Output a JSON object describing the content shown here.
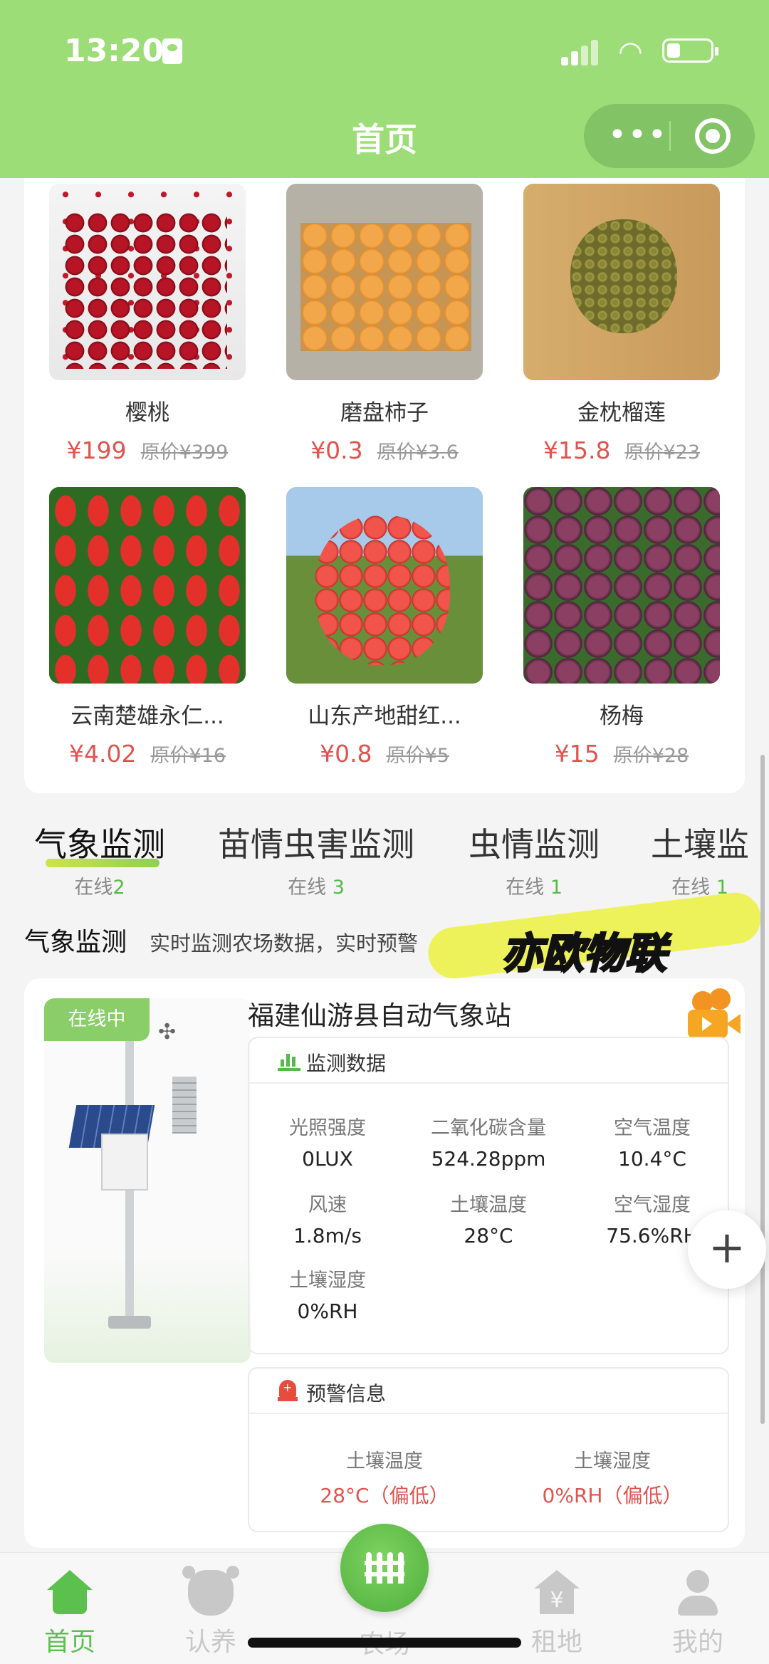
{
  "status_bar": {
    "time": "13:20"
  },
  "nav": {
    "title": "首页",
    "more_icon": "more-dots-icon",
    "close_icon": "target-close-icon"
  },
  "products": [
    {
      "name": "樱桃",
      "price": "¥199",
      "original": "原价¥399"
    },
    {
      "name": "磨盘柿子",
      "price": "¥0.3",
      "original": "原价¥3.6"
    },
    {
      "name": "金枕榴莲",
      "price": "¥15.8",
      "original": "原价¥23"
    },
    {
      "name": "云南楚雄永仁...",
      "price": "¥4.02",
      "original": "原价¥16"
    },
    {
      "name": "山东产地甜红...",
      "price": "¥0.8",
      "original": "原价¥5"
    },
    {
      "name": "杨梅",
      "price": "¥15",
      "original": "原价¥28"
    }
  ],
  "monitor_tabs": [
    {
      "label": "气象监测",
      "online_prefix": "在线",
      "online_count": "2",
      "active": true
    },
    {
      "label": "苗情虫害监测",
      "online_prefix": "在线",
      "online_count": "3",
      "active": false
    },
    {
      "label": "虫情监测",
      "online_prefix": "在线",
      "online_count": "1",
      "active": false
    },
    {
      "label": "土壤监",
      "online_prefix": "在线",
      "online_count": "1",
      "active": false
    }
  ],
  "section": {
    "title": "气象监测",
    "subtitle": "实时监测农场数据，实时预警",
    "watermark": "亦欧物联"
  },
  "device": {
    "status_badge": "在线中",
    "name": "福建仙游县自动气象站",
    "monitor_title": "监测数据",
    "metrics": [
      {
        "label": "光照强度",
        "value": "0LUX"
      },
      {
        "label": "二氧化碳含量",
        "value": "524.28ppm"
      },
      {
        "label": "空气温度",
        "value": "10.4°C"
      },
      {
        "label": "风速",
        "value": "1.8m/s"
      },
      {
        "label": "土壤温度",
        "value": "28°C"
      },
      {
        "label": "空气湿度",
        "value": "75.6%RH"
      },
      {
        "label": "土壤湿度",
        "value": "0%RH"
      }
    ],
    "warning_title": "预警信息",
    "warnings": [
      {
        "label": "土壤温度",
        "value": "28°C（偏低）"
      },
      {
        "label": "土壤湿度",
        "value": "0%RH（偏低）"
      }
    ]
  },
  "fab": {
    "symbol": "+"
  },
  "tabbar": {
    "items": [
      {
        "label": "首页",
        "icon": "home-icon",
        "active": true
      },
      {
        "label": "认养",
        "icon": "cow-icon",
        "active": false
      },
      {
        "label": "农场",
        "icon": "fence-icon",
        "active": false
      },
      {
        "label": "租地",
        "icon": "rent-house-icon",
        "active": false
      },
      {
        "label": "我的",
        "icon": "user-icon",
        "active": false
      }
    ]
  },
  "colors": {
    "primary": "#9ddd78",
    "accent_green": "#5cc04f",
    "price_red": "#e1534e"
  }
}
